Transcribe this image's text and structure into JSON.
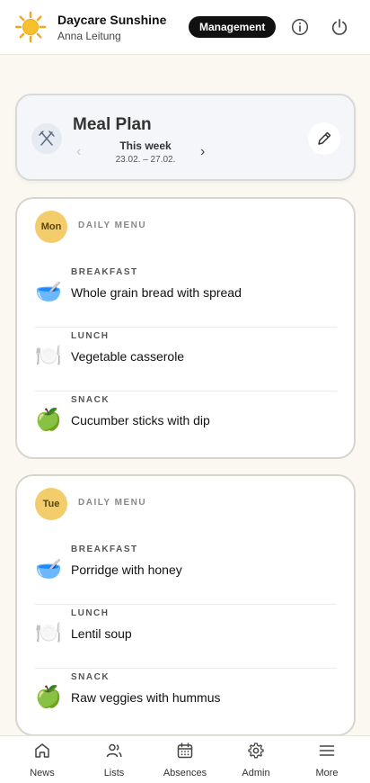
{
  "header": {
    "org_name": "Daycare Sunshine",
    "user_name": "Anna Leitung",
    "role_badge": "Management",
    "icons": [
      "sun-logo",
      "info-icon",
      "power-icon"
    ]
  },
  "plan": {
    "title": "Meal Plan",
    "week_label": "This week",
    "week_range": "23.02. – 27.02.",
    "icons": [
      "fork-knife-icon",
      "chevron-left-icon",
      "chevron-right-icon",
      "pencil-icon"
    ]
  },
  "days": [
    {
      "badge": "Mon",
      "subtitle": "DAILY MENU",
      "meals": [
        {
          "type": "BREAKFAST",
          "name": "Whole grain bread with spread",
          "emoji": "🥣"
        },
        {
          "type": "LUNCH",
          "name": "Vegetable casserole",
          "emoji": "🍽️"
        },
        {
          "type": "SNACK",
          "name": "Cucumber sticks with dip",
          "emoji": "🍏"
        }
      ]
    },
    {
      "badge": "Tue",
      "subtitle": "DAILY MENU",
      "meals": [
        {
          "type": "BREAKFAST",
          "name": "Porridge with honey",
          "emoji": "🥣"
        },
        {
          "type": "LUNCH",
          "name": "Lentil soup",
          "emoji": "🍽️"
        },
        {
          "type": "SNACK",
          "name": "Raw veggies with hummus",
          "emoji": "🍏"
        }
      ]
    }
  ],
  "nav": {
    "items": [
      {
        "label": "News",
        "icon": "home-icon"
      },
      {
        "label": "Lists",
        "icon": "users-icon"
      },
      {
        "label": "Absences",
        "icon": "calendar-icon"
      },
      {
        "label": "Admin",
        "icon": "gear-icon"
      },
      {
        "label": "More",
        "icon": "menu-icon"
      }
    ]
  },
  "colors": {
    "background": "#fbf8f1",
    "badge_day": "#f3cc6c",
    "management_badge": "#111111",
    "card_border": "#d8d5cf"
  }
}
